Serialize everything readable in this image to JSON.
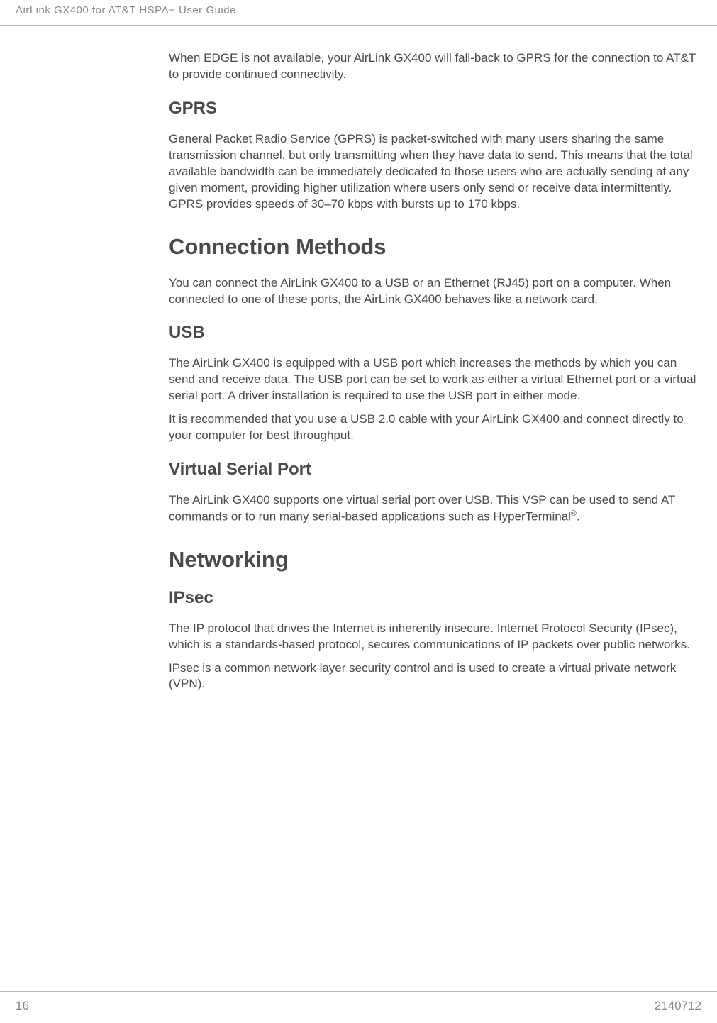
{
  "header": {
    "title": "AirLink GX400 for AT&T HSPA+ User Guide"
  },
  "intro_para": "When EDGE is not available, your AirLink GX400 will fall-back to GPRS for the connection to AT&T to provide continued connectivity.",
  "sections": {
    "gprs": {
      "heading": "GPRS",
      "para": "General Packet Radio Service (GPRS) is packet-switched with many users sharing the same transmission channel, but only transmitting when they have data to send. This means that the total available bandwidth can be immediately dedicated to those users who are actually sending at any given moment, providing higher utilization where users only send or receive data intermittently. GPRS provides speeds of 30–70 kbps with bursts up to 170 kbps."
    },
    "connection_methods": {
      "heading": "Connection Methods",
      "para": "You can connect the AirLink GX400 to a USB or an Ethernet (RJ45) port on a computer. When connected to one of these ports, the AirLink GX400 behaves like a network card."
    },
    "usb": {
      "heading": "USB",
      "para1": "The AirLink GX400 is equipped with a USB port which increases the methods by which you can send and receive data. The USB port can be set to work as either a virtual Ethernet port or a virtual serial port. A driver installation is required to use the USB port in either mode.",
      "para2": "It is recommended that you use a USB 2.0 cable with your AirLink GX400 and connect directly to your computer for best throughput."
    },
    "vsp": {
      "heading": "Virtual Serial Port",
      "para_prefix": "The AirLink GX400 supports one virtual serial port over USB. This VSP can be used to send AT commands or to run many serial-based applications such as HyperTerminal",
      "reg": "®",
      "para_suffix": "."
    },
    "networking": {
      "heading": "Networking"
    },
    "ipsec": {
      "heading": "IPsec",
      "para1": "The IP protocol that drives the Internet is inherently insecure. Internet Protocol Security (IPsec), which is a standards-based protocol, secures communications of IP packets over public networks.",
      "para2": "IPsec is a common network layer security control and is used to create a virtual private network (VPN)."
    }
  },
  "footer": {
    "page": "16",
    "docnum": "2140712"
  }
}
